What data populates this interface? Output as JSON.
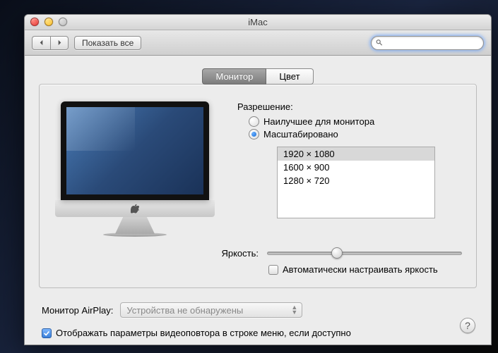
{
  "window": {
    "title": "iMac"
  },
  "toolbar": {
    "show_all": "Показать все",
    "search_placeholder": ""
  },
  "tabs": {
    "monitor": "Монитор",
    "color": "Цвет"
  },
  "resolution": {
    "label": "Разрешение:",
    "best": "Наилучшее для монитора",
    "scaled": "Масштабировано",
    "options": [
      "1920 × 1080",
      "1600 × 900",
      "1280 × 720"
    ]
  },
  "brightness": {
    "label": "Яркость:",
    "auto": "Автоматически настраивать яркость",
    "value_percent": 33
  },
  "airplay": {
    "label": "Монитор AirPlay:",
    "value": "Устройства не обнаружены"
  },
  "mirror": {
    "label": "Отображать параметры видеоповтора в строке меню, если доступно"
  },
  "help": "?"
}
